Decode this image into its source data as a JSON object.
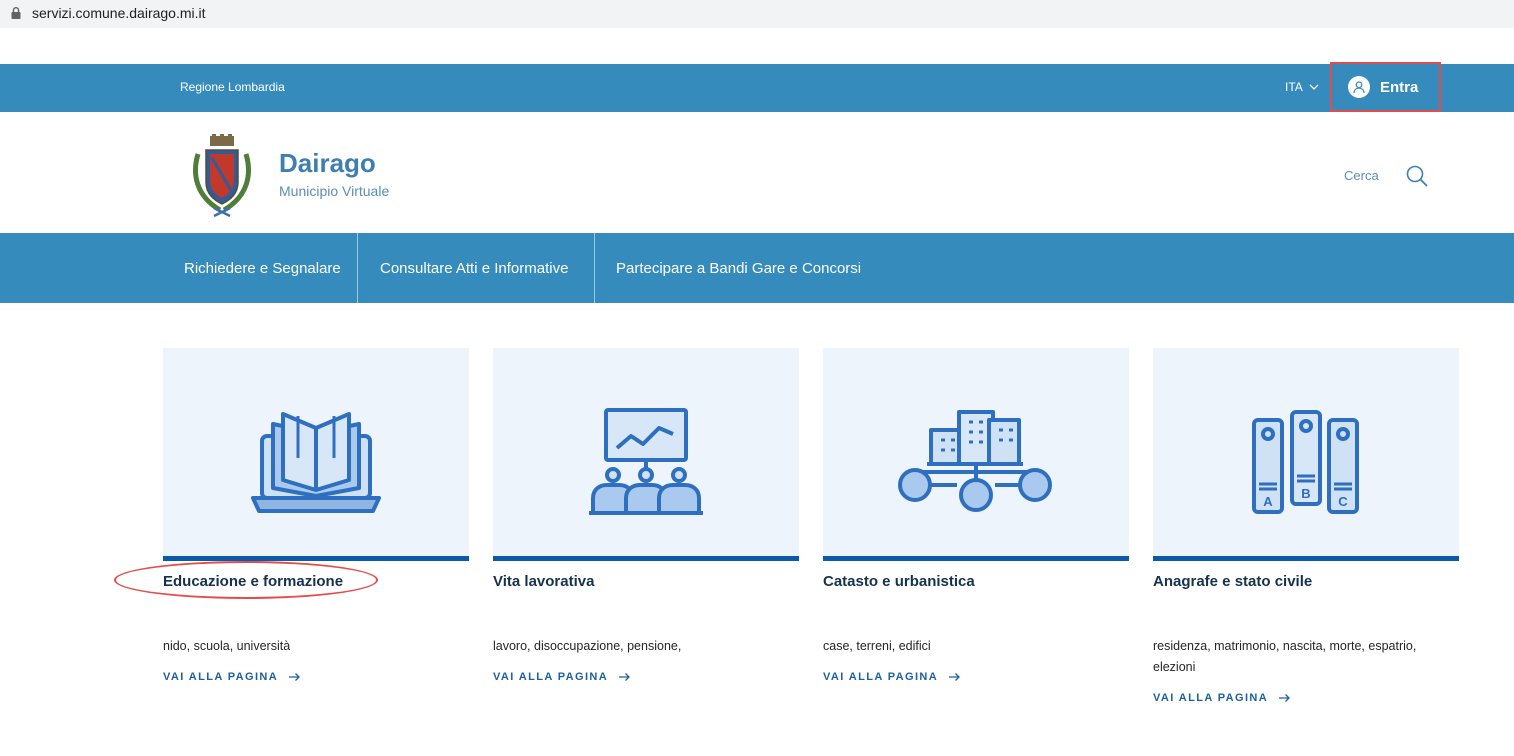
{
  "browser": {
    "url": "servizi.comune.dairago.mi.it"
  },
  "topbar": {
    "region": "Regione Lombardia",
    "language": "ITA",
    "login_label": "Entra"
  },
  "header": {
    "title": "Dairago",
    "subtitle": "Municipio Virtuale",
    "search_label": "Cerca"
  },
  "nav": {
    "items": [
      {
        "label": "Richiedere e Segnalare"
      },
      {
        "label": "Consultare Atti e Informative"
      },
      {
        "label": "Partecipare a Bandi Gare e Concorsi"
      }
    ]
  },
  "cards": [
    {
      "title": "Educazione e formazione",
      "description": "nido, scuola, università",
      "link": "VAI ALLA PAGINA",
      "icon": "book-laptop-icon"
    },
    {
      "title": "Vita lavorativa",
      "description": "lavoro, disoccupazione, pensione,",
      "link": "VAI ALLA PAGINA",
      "icon": "presentation-icon"
    },
    {
      "title": "Catasto e urbanistica",
      "description": "case, terreni, edifici",
      "link": "VAI ALLA PAGINA",
      "icon": "city-network-icon"
    },
    {
      "title": "Anagrafe e stato civile",
      "description": "residenza, matrimonio, nascita, morte, espatrio, elezioni",
      "link": "VAI ALLA PAGINA",
      "icon": "binders-icon"
    }
  ],
  "colors": {
    "primary": "#368bbd",
    "card_bar": "#0b5aa8",
    "card_bg": "#eef4fb",
    "title": "#17324d",
    "highlight": "#e64b4b"
  }
}
